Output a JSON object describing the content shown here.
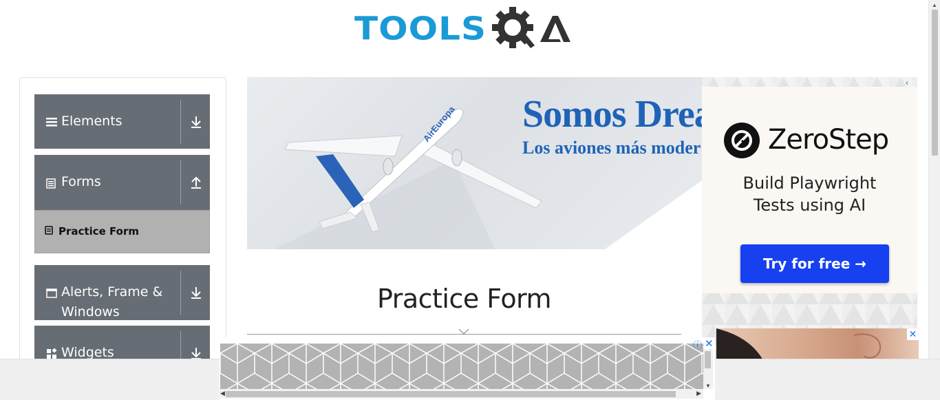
{
  "header": {
    "logo_left": "TOOLS",
    "logo_right": "A"
  },
  "sidebar": {
    "groups": [
      {
        "label": "Elements",
        "icon": "hamburger-icon",
        "toggle": "download-arrow-icon"
      },
      {
        "label": "Forms",
        "icon": "document-icon",
        "toggle": "upload-arrow-icon"
      },
      {
        "label": "Alerts, Frame &",
        "label2": "Windows",
        "icon": "window-icon",
        "toggle": "download-arrow-icon"
      },
      {
        "label": "Widgets",
        "icon": "widgets-icon",
        "toggle": "download-arrow-icon"
      }
    ],
    "forms_items": [
      {
        "label": "Practice Form",
        "icon": "form-icon"
      }
    ]
  },
  "banner_ad": {
    "headline": "Somos Drea",
    "subline": "Los aviones más moder",
    "plane_text": "AirEuropa"
  },
  "side_ad": {
    "brand": "ZeroStep",
    "tagline_1": "Build Playwright",
    "tagline_2": "Tests using AI",
    "cta": "Try for free →",
    "back_icon": "‹"
  },
  "main": {
    "title": "Practice Form"
  },
  "bottom_ad": {
    "info_icon": "ⓘ",
    "close_icon": "✕"
  },
  "colors": {
    "brand_blue": "#1a9ad6",
    "sidebar_group": "#676d75",
    "sidebar_active": "#b1b1b1",
    "cta_blue": "#1640f0",
    "banner_blue": "#1f63b8"
  }
}
